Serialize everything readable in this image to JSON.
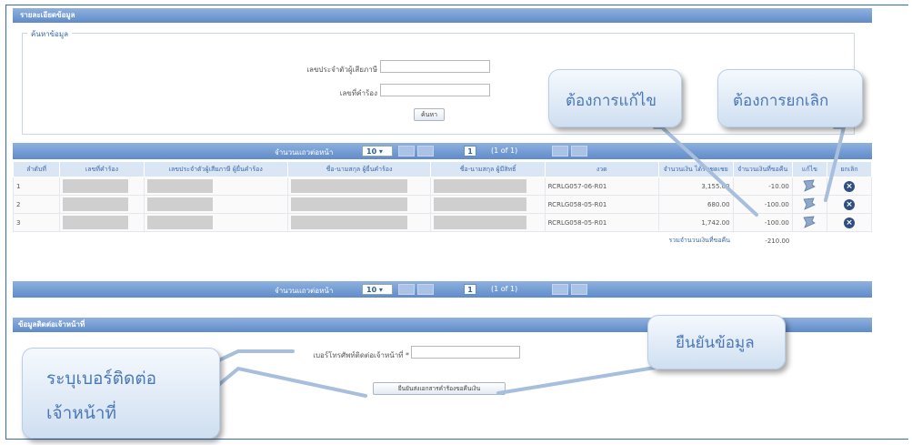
{
  "form": {
    "title": "รายละเอียดข้อมูล",
    "legend": "ค้นหาข้อมูล",
    "label_taxid": "เลขประจำตัวผู้เสียภาษี",
    "label_docno": "เลขที่คำร้อง",
    "search_button": "ค้นหา"
  },
  "pager": {
    "label": "จำนวนแถวต่อหน้า",
    "per_page": "10 ▾",
    "page": "1",
    "of": "(1 of 1)"
  },
  "table": {
    "headers": [
      "ลำดับที่",
      "เลขที่คำร้อง",
      "เลขประจำตัวผู้เสียภาษี ผู้ยื่นคำร้อง",
      "ชื่อ-นามสกุล ผู้ยื่นคำร้อง",
      "ชื่อ-นามสกุล ผู้มีสิทธิ์",
      "งวด",
      "จำนวนเงิน ได้รับชดเชย",
      "จำนวนเงินที่ขอคืน",
      "แก้ไข",
      "ยกเลิก"
    ],
    "rows": [
      {
        "no": "1",
        "period": "RCRLG057-06-R01",
        "amount": "3,155.00",
        "refund": "-10.00"
      },
      {
        "no": "2",
        "period": "RCRLG058-05-R01",
        "amount": "680.00",
        "refund": "-100.00"
      },
      {
        "no": "3",
        "period": "RCRLG058-05-R01",
        "amount": "1,742.00",
        "refund": "-100.00"
      }
    ],
    "total_label": "รวมจำนวนเงินที่ขอคืน",
    "total_value": "-210.00"
  },
  "contact": {
    "title": "ข้อมูลติดต่อเจ้าหน้าที่",
    "phone_label": "เบอร์โทรศัพท์ติดต่อเจ้าหน้าที่ *",
    "confirm_button": "ยืนยันส่งเอกสารคำร้องขอคืนเงิน"
  },
  "callouts": {
    "edit": "ต้องการแก้ไข",
    "cancel": "ต้องการยกเลิก",
    "confirm": "ยืนยันข้อมูล",
    "phone_line1": "ระบุเบอร์ติดต่อ",
    "phone_line2": "เจ้าหน้าที่"
  },
  "colors": {
    "header_blue": "#5f8bca",
    "callout_text": "#4a78b5"
  }
}
